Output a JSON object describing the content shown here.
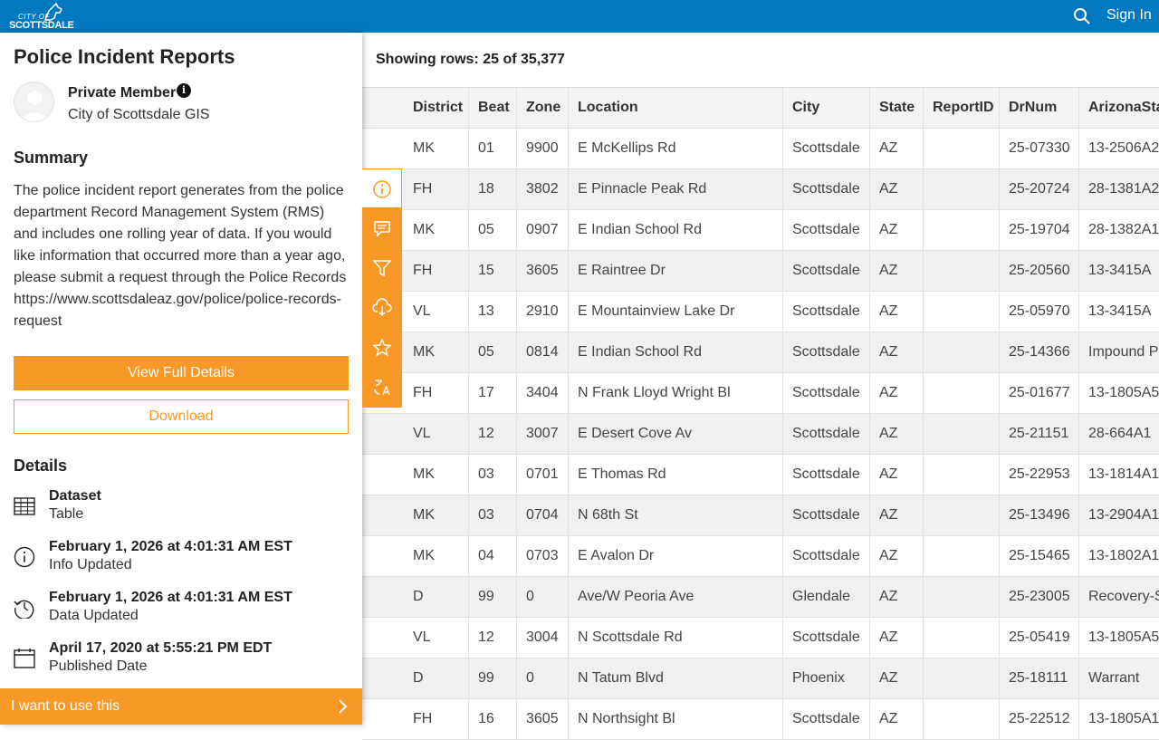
{
  "header": {
    "logo_top": "CITY OF",
    "logo_bottom": "SCOTTSDALE",
    "sign_in": "Sign In"
  },
  "panel": {
    "title": "Police Incident Reports",
    "owner": "Private Member",
    "org": "City of Scottsdale GIS",
    "summary_heading": "Summary",
    "summary": "The police incident report generates from the police department Record Management System (RMS) and includes one rolling year of data. If you would like information that occurred more than a year ago, please submit a request through the Police Records https://www.scottsdaleaz.gov/police/police-records-request",
    "view_full_details": "View Full Details",
    "download": "Download",
    "details_heading": "Details",
    "details": [
      {
        "icon": "table-icon",
        "title": "Dataset",
        "sub": "Table"
      },
      {
        "icon": "info-circle-icon",
        "title": "February 1, 2026 at 4:01:31 AM EST",
        "sub": "Info Updated"
      },
      {
        "icon": "history-icon",
        "title": "February 1, 2026 at 4:01:31 AM EST",
        "sub": "Data Updated"
      },
      {
        "icon": "calendar-icon",
        "title": "April 17, 2020 at 5:55:21 PM EDT",
        "sub": "Published Date"
      }
    ],
    "use_this": "I want to use this"
  },
  "table": {
    "rows_label": "Showing rows: 25 of 35,377",
    "columns": [
      "",
      "District",
      "Beat",
      "Zone",
      "Location",
      "City",
      "State",
      "ReportID",
      "DrNum",
      "ArizonaStat"
    ],
    "rows": [
      [
        "",
        "MK",
        "01",
        "9900",
        "E McKellips Rd",
        "Scottsdale",
        "AZ",
        "",
        "25-07330",
        "13-2506A2"
      ],
      [
        "",
        "FH",
        "18",
        "3802",
        "E Pinnacle Peak Rd",
        "Scottsdale",
        "AZ",
        "",
        "25-20724",
        "28-1381A2"
      ],
      [
        "",
        "MK",
        "05",
        "0907",
        "E Indian School Rd",
        "Scottsdale",
        "AZ",
        "",
        "25-19704",
        "28-1382A1"
      ],
      [
        "",
        "FH",
        "15",
        "3605",
        "E Raintree Dr",
        "Scottsdale",
        "AZ",
        "",
        "25-20560",
        "13-3415A"
      ],
      [
        "",
        "VL",
        "13",
        "2910",
        "E Mountainview Lake Dr",
        "Scottsdale",
        "AZ",
        "",
        "25-05970",
        "13-3415A"
      ],
      [
        "",
        "MK",
        "05",
        "0814",
        "E Indian School Rd",
        "Scottsdale",
        "AZ",
        "",
        "25-14366",
        "Impound P"
      ],
      [
        "",
        "FH",
        "17",
        "3404",
        "N Frank Lloyd Wright Bl",
        "Scottsdale",
        "AZ",
        "",
        "25-01677",
        "13-1805A5"
      ],
      [
        "",
        "VL",
        "12",
        "3007",
        "E Desert Cove Av",
        "Scottsdale",
        "AZ",
        "",
        "25-21151",
        "28-664A1"
      ],
      [
        "",
        "MK",
        "03",
        "0701",
        "E Thomas Rd",
        "Scottsdale",
        "AZ",
        "",
        "25-22953",
        "13-1814A1"
      ],
      [
        "",
        "MK",
        "03",
        "0704",
        "N 68th St",
        "Scottsdale",
        "AZ",
        "",
        "25-13496",
        "13-2904A1"
      ],
      [
        "",
        "MK",
        "04",
        "0703",
        "E Avalon Dr",
        "Scottsdale",
        "AZ",
        "",
        "25-15465",
        "13-1802A1"
      ],
      [
        "",
        "D",
        "99",
        "0",
        "Ave/W Peoria Ave",
        "Glendale",
        "AZ",
        "",
        "25-23005",
        "Recovery-S"
      ],
      [
        "",
        "VL",
        "12",
        "3004",
        "N Scottsdale Rd",
        "Scottsdale",
        "AZ",
        "",
        "25-05419",
        "13-1805A5"
      ],
      [
        "",
        "D",
        "99",
        "0",
        "N Tatum Blvd",
        "Phoenix",
        "AZ",
        "",
        "25-18111",
        "Warrant"
      ],
      [
        "",
        "FH",
        "16",
        "3605",
        "N Northsight Bl",
        "Scottsdale",
        "AZ",
        "",
        "25-22512",
        "13-1805A1"
      ]
    ]
  },
  "toolstrip": [
    {
      "icon": "info-icon",
      "active": true
    },
    {
      "icon": "comment-icon",
      "active": false
    },
    {
      "icon": "filter-icon",
      "active": false
    },
    {
      "icon": "cloud-download-icon",
      "active": false
    },
    {
      "icon": "star-icon",
      "active": false
    },
    {
      "icon": "translate-icon",
      "active": false
    }
  ],
  "colors": {
    "header": "#0079c1",
    "accent": "#f89927"
  }
}
